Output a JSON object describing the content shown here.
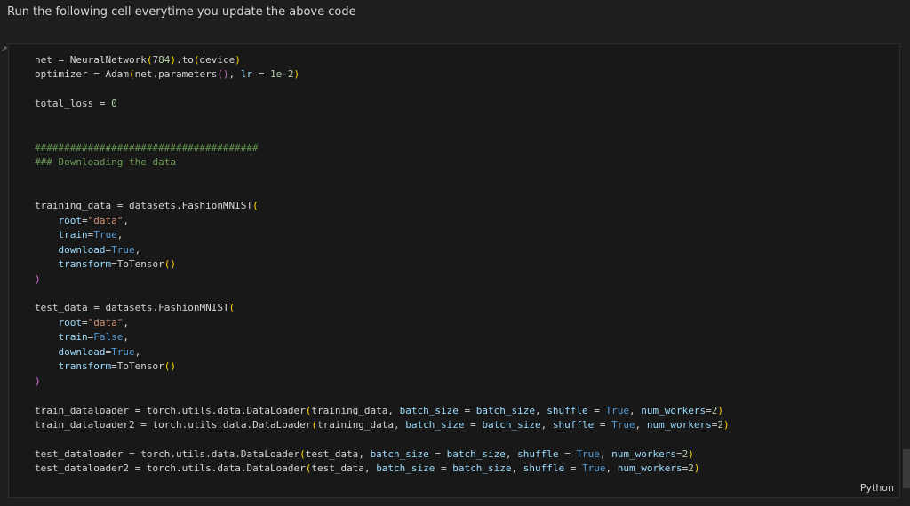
{
  "markdown": {
    "text": "Run the following cell everytime you update the above code"
  },
  "cell": {
    "language": "Python",
    "code_lines": [
      "net = NeuralNetwork(784).to(device)",
      "optimizer = Adam(net.parameters(), lr = 1e-2)",
      "",
      "total_loss = 0",
      "",
      "",
      "######################################",
      "### Downloading the data",
      "",
      "",
      "training_data = datasets.FashionMNIST(",
      "    root=\"data\",",
      "    train=True,",
      "    download=True,",
      "    transform=ToTensor()",
      ")",
      "",
      "test_data = datasets.FashionMNIST(",
      "    root=\"data\",",
      "    train=False,",
      "    download=True,",
      "    transform=ToTensor()",
      ")",
      "",
      "train_dataloader = torch.utils.data.DataLoader(training_data, batch_size = batch_size, shuffle = True, num_workers=2)",
      "train_dataloader2 = torch.utils.data.DataLoader(training_data, batch_size = batch_size, shuffle = True, num_workers=2)",
      "",
      "test_dataloader = torch.utils.data.DataLoader(test_data, batch_size = batch_size, shuffle = True, num_workers=2)",
      "test_dataloader2 = torch.utils.data.DataLoader(test_data, batch_size = batch_size, shuffle = True, num_workers=2)"
    ]
  },
  "colors": {
    "background": "#1e1e1e",
    "cell_background": "#181818",
    "keyword": "#569cd6",
    "string": "#ce9178",
    "number": "#b5cea8",
    "parameter": "#9cdcfe",
    "comment": "#6a9955",
    "bracket_1": "#ffd700",
    "bracket_2": "#da70d6"
  },
  "icons": {
    "cell_corner": "collapse-corner-icon"
  }
}
